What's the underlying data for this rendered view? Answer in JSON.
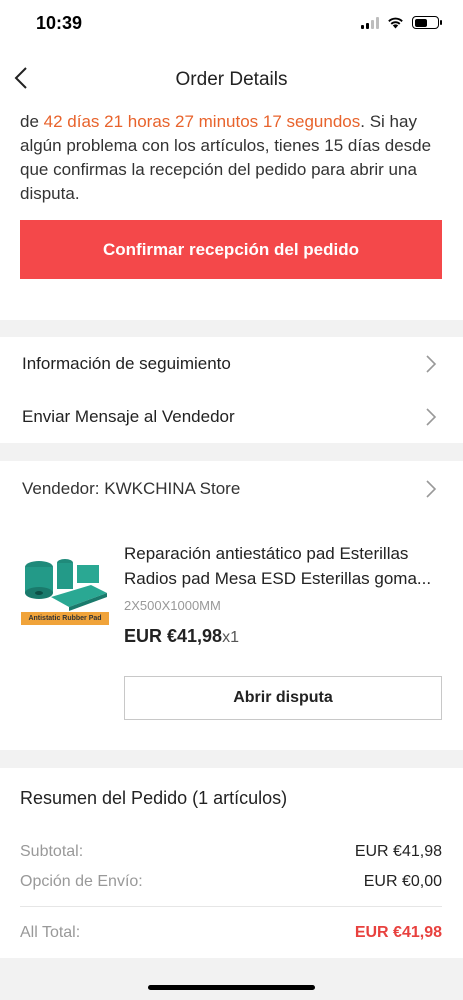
{
  "status_bar": {
    "time": "10:39"
  },
  "nav": {
    "title": "Order Details"
  },
  "notice": {
    "prefix": "de ",
    "countdown": "42 días 21 horas 27 minutos 17 segundos",
    "suffix": ". Si hay algún problema con los artículos, tienes 15 días desde que confirmas la recepción del pedido para abrir una disputa.",
    "confirm_button": "Confirmar recepción del pedido"
  },
  "links": {
    "tracking": "Información de seguimiento",
    "message_seller": "Enviar Mensaje al Vendedor"
  },
  "order": {
    "seller": "Vendedor: KWKCHINA Store",
    "product": {
      "title_line1": "Reparación antiestático pad Esterillas",
      "title_line2": "Radios pad Mesa ESD Esterillas goma...",
      "image_tag": "Antistatic Rubber Pad",
      "variant": "2X500X1000MM",
      "price": "EUR €41,98",
      "quantity": "x1"
    },
    "dispute_button": "Abrir disputa"
  },
  "summary": {
    "title": "Resumen del Pedido (1 artículos)",
    "subtotal_label": "Subtotal:",
    "subtotal_value": "EUR €41,98",
    "shipping_label": "Opción de Envío:",
    "shipping_value": "EUR €0,00",
    "total_label": "All Total:",
    "total_value": "EUR €41,98"
  },
  "colors": {
    "accent_orange": "#e8632c",
    "confirm_button": "#f4484a",
    "total_red": "#e8413e",
    "background": "#f2f2f2"
  },
  "icons": {
    "back": "chevron-left-icon",
    "row_chevron": "chevron-right-icon",
    "signal": "signal-icon",
    "wifi": "wifi-icon",
    "battery": "battery-icon"
  }
}
